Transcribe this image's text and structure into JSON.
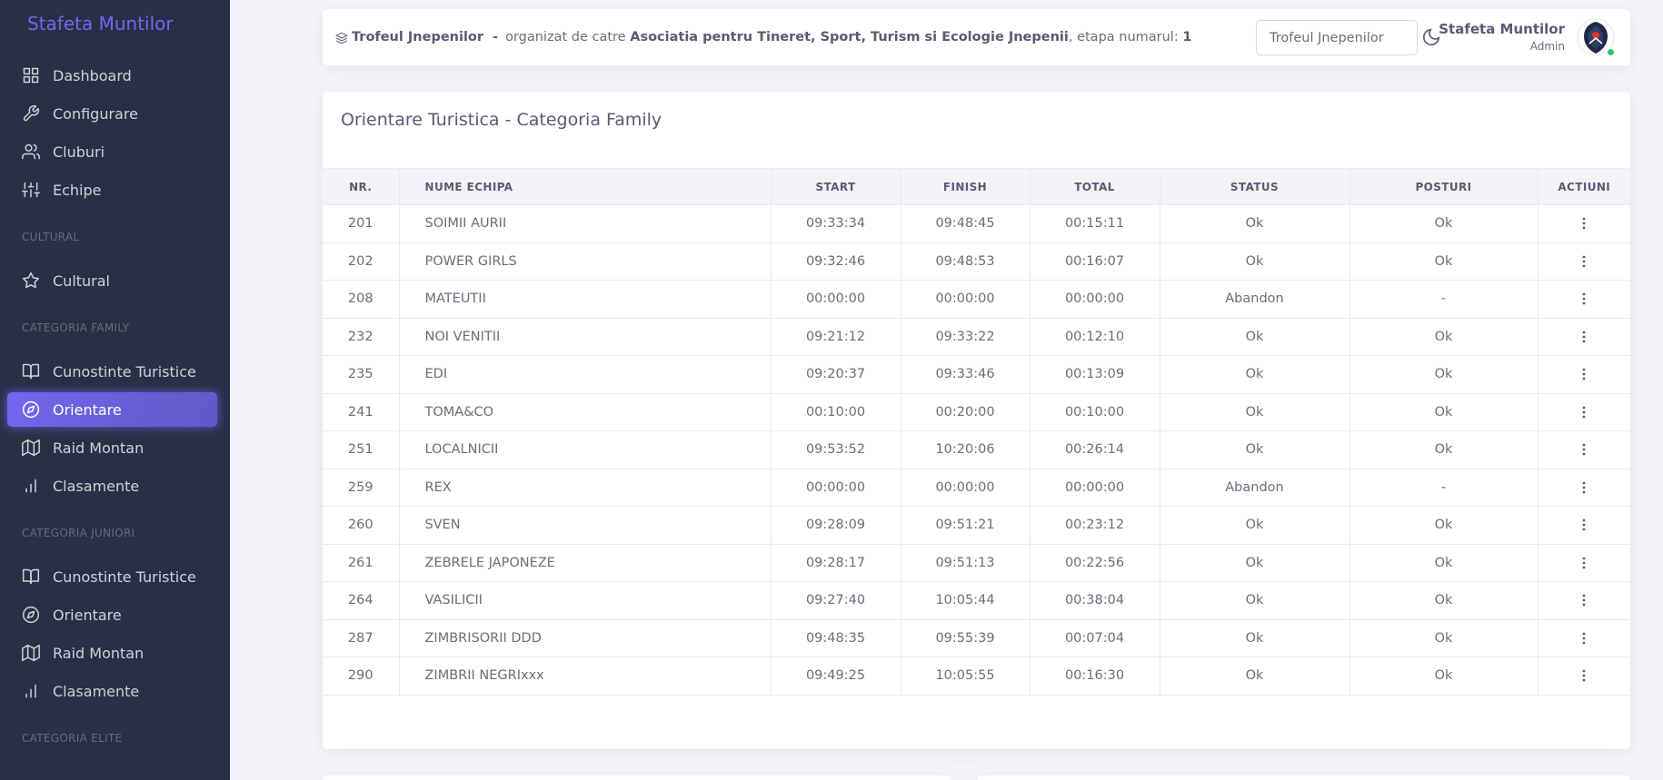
{
  "sidebar": {
    "brand": "Stafeta Muntilor",
    "items": [
      {
        "label": "Dashboard"
      },
      {
        "label": "Configurare"
      },
      {
        "label": "Cluburi"
      },
      {
        "label": "Echipe"
      }
    ],
    "sections": [
      {
        "title": "CULTURAL",
        "items": [
          {
            "label": "Cultural"
          }
        ]
      },
      {
        "title": "CATEGORIA FAMILY",
        "items": [
          {
            "label": "Cunostinte Turistice"
          },
          {
            "label": "Orientare"
          },
          {
            "label": "Raid Montan"
          },
          {
            "label": "Clasamente"
          }
        ]
      },
      {
        "title": "CATEGORIA JUNIORI",
        "items": [
          {
            "label": "Cunostinte Turistice"
          },
          {
            "label": "Orientare"
          },
          {
            "label": "Raid Montan"
          },
          {
            "label": "Clasamente"
          }
        ]
      },
      {
        "title": "CATEGORIA ELITE"
      }
    ],
    "active_item": "Orientare",
    "accent_color": "#7367f0"
  },
  "header": {
    "trophy_name": "Trofeul Jnepenilor",
    "separator": "-",
    "organized_by_label": "organizat de catre",
    "organizer": "Asociatia pentru Tineret, Sport, Turism si Ecologie Jnepenii",
    "stage_label": ", etapa numarul:",
    "stage_number": "1",
    "competition_select_value": "Trofeul Jnepenilor",
    "user_name": "Stafeta Muntilor",
    "user_role": "Admin",
    "online_status_color": "#28c76f"
  },
  "card": {
    "title": "Orientare Turistica - Categoria Family",
    "columns": [
      "NR.",
      "NUME ECHIPA",
      "START",
      "FINISH",
      "TOTAL",
      "STATUS",
      "POSTURI",
      "ACTIUNI"
    ],
    "rows": [
      {
        "nr": "201",
        "name": "SOIMII AURII",
        "start": "09:33:34",
        "finish": "09:48:45",
        "total": "00:15:11",
        "status": "Ok",
        "posturi": "Ok"
      },
      {
        "nr": "202",
        "name": "POWER GIRLS",
        "start": "09:32:46",
        "finish": "09:48:53",
        "total": "00:16:07",
        "status": "Ok",
        "posturi": "Ok"
      },
      {
        "nr": "208",
        "name": "MATEUTII",
        "start": "00:00:00",
        "finish": "00:00:00",
        "total": "00:00:00",
        "status": "Abandon",
        "posturi": "-"
      },
      {
        "nr": "232",
        "name": "NOI VENITII",
        "start": "09:21:12",
        "finish": "09:33:22",
        "total": "00:12:10",
        "status": "Ok",
        "posturi": "Ok"
      },
      {
        "nr": "235",
        "name": "EDI",
        "start": "09:20:37",
        "finish": "09:33:46",
        "total": "00:13:09",
        "status": "Ok",
        "posturi": "Ok"
      },
      {
        "nr": "241",
        "name": "TOMA&CO",
        "start": "00:10:00",
        "finish": "00:20:00",
        "total": "00:10:00",
        "status": "Ok",
        "posturi": "Ok"
      },
      {
        "nr": "251",
        "name": "LOCALNICII",
        "start": "09:53:52",
        "finish": "10:20:06",
        "total": "00:26:14",
        "status": "Ok",
        "posturi": "Ok"
      },
      {
        "nr": "259",
        "name": "REX",
        "start": "00:00:00",
        "finish": "00:00:00",
        "total": "00:00:00",
        "status": "Abandon",
        "posturi": "-"
      },
      {
        "nr": "260",
        "name": "SVEN",
        "start": "09:28:09",
        "finish": "09:51:21",
        "total": "00:23:12",
        "status": "Ok",
        "posturi": "Ok"
      },
      {
        "nr": "261",
        "name": "ZEBRELE JAPONEZE",
        "start": "09:28:17",
        "finish": "09:51:13",
        "total": "00:22:56",
        "status": "Ok",
        "posturi": "Ok"
      },
      {
        "nr": "264",
        "name": "VASILICII",
        "start": "09:27:40",
        "finish": "10:05:44",
        "total": "00:38:04",
        "status": "Ok",
        "posturi": "Ok"
      },
      {
        "nr": "287",
        "name": "ZIMBRISORII DDD",
        "start": "09:48:35",
        "finish": "09:55:39",
        "total": "00:07:04",
        "status": "Ok",
        "posturi": "Ok"
      },
      {
        "nr": "290",
        "name": "ZIMBRII NEGRIxxx",
        "start": "09:49:25",
        "finish": "10:05:55",
        "total": "00:16:30",
        "status": "Ok",
        "posturi": "Ok"
      }
    ],
    "row_action_icon": "more-vertical-icon"
  }
}
